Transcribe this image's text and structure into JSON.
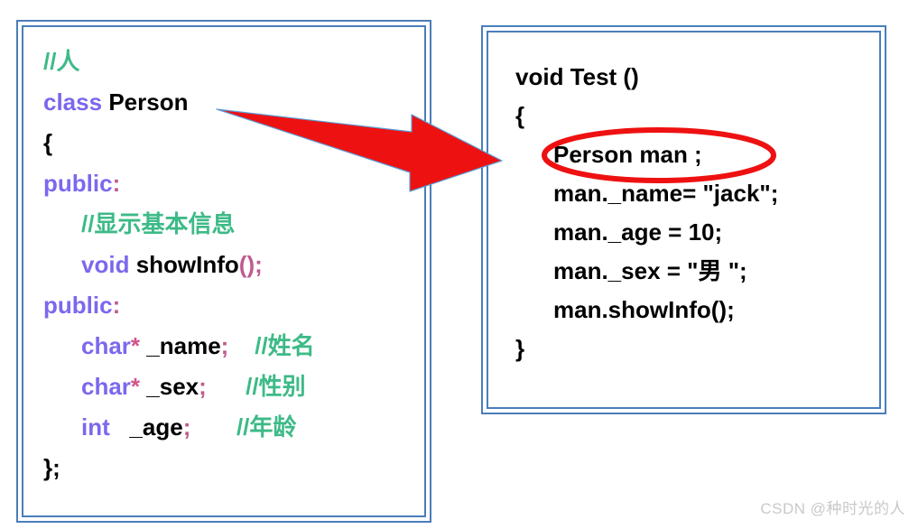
{
  "colors": {
    "frame_border": "#4a7ebb",
    "annotation_red": "#ee1111",
    "comment_green": "#3dba87",
    "keyword_purple": "#7b68ee",
    "punctuation_pink": "#c05a8f",
    "text_black": "#000000",
    "watermark_gray": "#c9c9c9",
    "background": "#ffffff"
  },
  "left_panel": {
    "title": "class-definition-code-block",
    "lines": [
      {
        "indent": 0,
        "tokens": [
          {
            "t": "//人",
            "c": "cmt"
          }
        ]
      },
      {
        "indent": 0,
        "tokens": [
          {
            "t": "class",
            "c": "kw"
          },
          {
            "t": " ",
            "c": "plain"
          },
          {
            "t": "Person",
            "c": "ident"
          }
        ]
      },
      {
        "indent": 0,
        "tokens": [
          {
            "t": "{",
            "c": "plain"
          }
        ]
      },
      {
        "indent": 0,
        "tokens": [
          {
            "t": "public",
            "c": "kw"
          },
          {
            "t": ":",
            "c": "punc"
          }
        ]
      },
      {
        "indent": 1,
        "tokens": [
          {
            "t": "//显示基本信息",
            "c": "cmt"
          }
        ]
      },
      {
        "indent": 1,
        "tokens": [
          {
            "t": "void",
            "c": "kw"
          },
          {
            "t": " ",
            "c": "plain"
          },
          {
            "t": "showInfo",
            "c": "ident"
          },
          {
            "t": "();",
            "c": "punc"
          }
        ]
      },
      {
        "indent": 0,
        "tokens": [
          {
            "t": "public",
            "c": "kw"
          },
          {
            "t": ":",
            "c": "punc"
          }
        ]
      },
      {
        "indent": 1,
        "tokens": [
          {
            "t": "char",
            "c": "kw"
          },
          {
            "t": "*",
            "c": "star"
          },
          {
            "t": " _name",
            "c": "ident"
          },
          {
            "t": ";",
            "c": "punc"
          },
          {
            "t": "    ",
            "c": "plain"
          },
          {
            "t": "//姓名",
            "c": "cmt"
          }
        ]
      },
      {
        "indent": 1,
        "tokens": [
          {
            "t": "char",
            "c": "kw"
          },
          {
            "t": "*",
            "c": "star"
          },
          {
            "t": " _sex",
            "c": "ident"
          },
          {
            "t": ";",
            "c": "punc"
          },
          {
            "t": "      ",
            "c": "plain"
          },
          {
            "t": "//性别",
            "c": "cmt"
          }
        ]
      },
      {
        "indent": 1,
        "tokens": [
          {
            "t": "int",
            "c": "kw"
          },
          {
            "t": "   _age",
            "c": "ident"
          },
          {
            "t": ";",
            "c": "punc"
          },
          {
            "t": "       ",
            "c": "plain"
          },
          {
            "t": "//年龄",
            "c": "cmt"
          }
        ]
      },
      {
        "indent": 0,
        "tokens": [
          {
            "t": "};",
            "c": "plain"
          }
        ]
      }
    ]
  },
  "right_panel": {
    "title": "test-function-code-block",
    "lines": [
      {
        "indent": 0,
        "tokens": [
          {
            "t": "void Test ()",
            "c": "plain"
          }
        ]
      },
      {
        "indent": 0,
        "tokens": [
          {
            "t": "{",
            "c": "plain"
          }
        ]
      },
      {
        "indent": 1,
        "tokens": [
          {
            "t": "Person man ;",
            "c": "plain"
          }
        ]
      },
      {
        "indent": 1,
        "tokens": [
          {
            "t": "man._name= \"jack\";",
            "c": "plain"
          }
        ]
      },
      {
        "indent": 1,
        "tokens": [
          {
            "t": "man._age = 10;",
            "c": "plain"
          }
        ]
      },
      {
        "indent": 1,
        "tokens": [
          {
            "t": "man._sex = \"男 \";",
            "c": "plain"
          }
        ]
      },
      {
        "indent": 1,
        "tokens": [
          {
            "t": "man.showInfo();",
            "c": "plain"
          }
        ]
      },
      {
        "indent": 0,
        "tokens": [
          {
            "t": "}",
            "c": "plain"
          }
        ]
      }
    ]
  },
  "annotations": {
    "arrow": {
      "name": "red-pointer-arrow",
      "from_label": "Person",
      "to_label": "Person man ;"
    },
    "ellipse": {
      "name": "red-highlight-ellipse",
      "encircles": "Person man ;"
    }
  },
  "watermark": {
    "text": "CSDN @种时光的人"
  }
}
